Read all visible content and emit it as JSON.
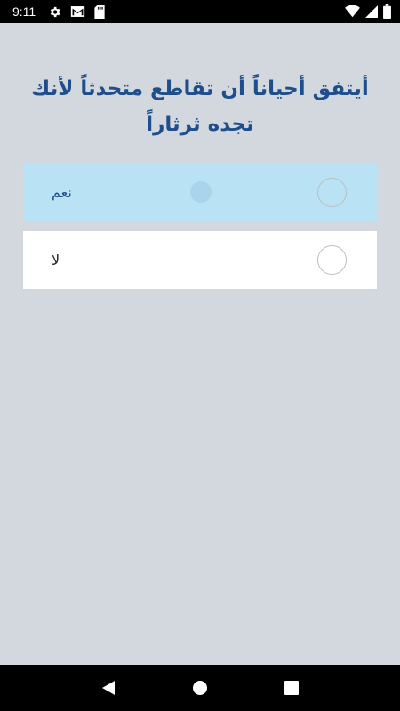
{
  "status_bar": {
    "time": "9:11",
    "left_icons": [
      "gear-icon",
      "gmail-icon",
      "sd-card-icon"
    ],
    "right_icons": [
      "wifi-icon",
      "signal-icon",
      "battery-icon"
    ]
  },
  "question": {
    "text": "أيتفق أحياناً أن تقاطع متحدثاً لأنك تجده ثرثاراً"
  },
  "options": [
    {
      "label": "نعم",
      "selected": true
    },
    {
      "label": "لا",
      "selected": false
    }
  ],
  "nav_bar": {
    "buttons": [
      "back-icon",
      "home-icon",
      "recents-icon"
    ]
  },
  "colors": {
    "background": "#d3d8df",
    "question_text": "#1f4e8c",
    "selected_option": "#b9e2f5",
    "option_background": "#ffffff"
  }
}
